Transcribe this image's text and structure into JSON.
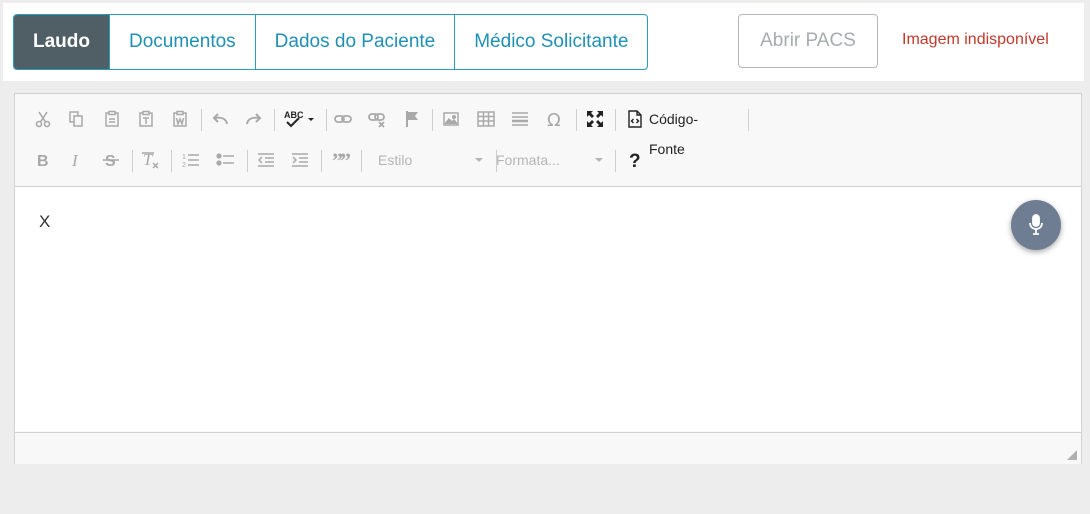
{
  "tabs": [
    {
      "label": "Laudo",
      "active": true
    },
    {
      "label": "Documentos",
      "active": false
    },
    {
      "label": "Dados do Paciente",
      "active": false
    },
    {
      "label": "Médico Solicitante",
      "active": false
    }
  ],
  "pacs_button": {
    "label": "Abrir PACS",
    "enabled": false
  },
  "image_status": "Imagem indisponível",
  "toolbar": {
    "source_label": "Código-Fonte",
    "style_combo": "Estilo",
    "format_combo": "Formata..."
  },
  "editor": {
    "content": "X"
  },
  "icons": {
    "row1": [
      "cut-icon",
      "copy-icon",
      "paste-icon",
      "paste-text-icon",
      "paste-word-icon",
      "undo-icon",
      "redo-icon",
      "spellcheck-icon",
      "link-icon",
      "unlink-icon",
      "anchor-icon",
      "image-icon",
      "table-icon",
      "horizontal-rule-icon",
      "special-char-icon",
      "maximize-icon",
      "source-icon"
    ],
    "row2": [
      "bold-icon",
      "italic-icon",
      "strike-icon",
      "remove-format-icon",
      "numbered-list-icon",
      "bulleted-list-icon",
      "outdent-icon",
      "indent-icon",
      "blockquote-icon",
      "help-icon",
      "microphone-icon"
    ]
  },
  "colors": {
    "accent": "#2a9bbd",
    "active_tab": "#505e66",
    "status_error": "#c0392b",
    "mic_button": "#6f7d92"
  }
}
